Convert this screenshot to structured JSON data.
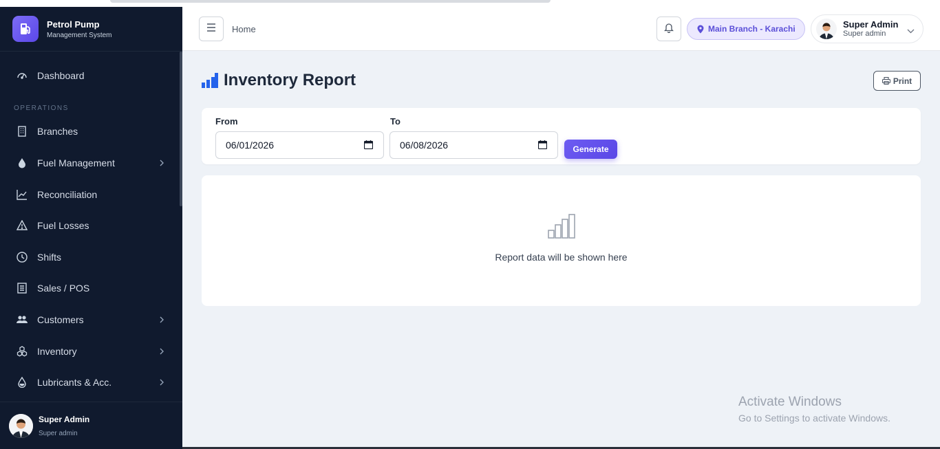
{
  "brand": {
    "title": "Petrol Pump",
    "subtitle": "Management System"
  },
  "sidebar": {
    "items": [
      {
        "label": "Dashboard",
        "icon": "gauge-icon"
      },
      {
        "section": "OPERATIONS"
      },
      {
        "label": "Branches",
        "icon": "building-icon"
      },
      {
        "label": "Fuel Management",
        "icon": "droplet-icon",
        "has_submenu": true
      },
      {
        "label": "Reconciliation",
        "icon": "chart-line-icon"
      },
      {
        "label": "Fuel Losses",
        "icon": "warning-icon"
      },
      {
        "label": "Shifts",
        "icon": "clock-icon"
      },
      {
        "label": "Sales / POS",
        "icon": "receipt-icon"
      },
      {
        "label": "Customers",
        "icon": "users-icon",
        "has_submenu": true
      },
      {
        "label": "Inventory",
        "icon": "cubes-icon",
        "has_submenu": true
      },
      {
        "label": "Lubricants & Acc.",
        "icon": "oil-drop-icon",
        "has_submenu": true
      }
    ],
    "user": {
      "name": "Super Admin",
      "role": "Super admin"
    }
  },
  "header": {
    "breadcrumb": "Home",
    "branch": "Main Branch - Karachi",
    "user": {
      "name": "Super Admin",
      "role": "Super admin"
    }
  },
  "page": {
    "title": "Inventory Report",
    "print_label": "Print",
    "filters": {
      "from_label": "From",
      "from_value": "06/01/2026",
      "to_label": "To",
      "to_value": "06/08/2026",
      "generate_label": "Generate"
    },
    "empty_text": "Report data will be shown here"
  },
  "watermark": {
    "line1": "Activate Windows",
    "line2": "Go to Settings to activate Windows."
  },
  "colors": {
    "sidebar_bg": "#101a2e",
    "accent": "#5b48e8",
    "title_icon": "#2563eb"
  }
}
